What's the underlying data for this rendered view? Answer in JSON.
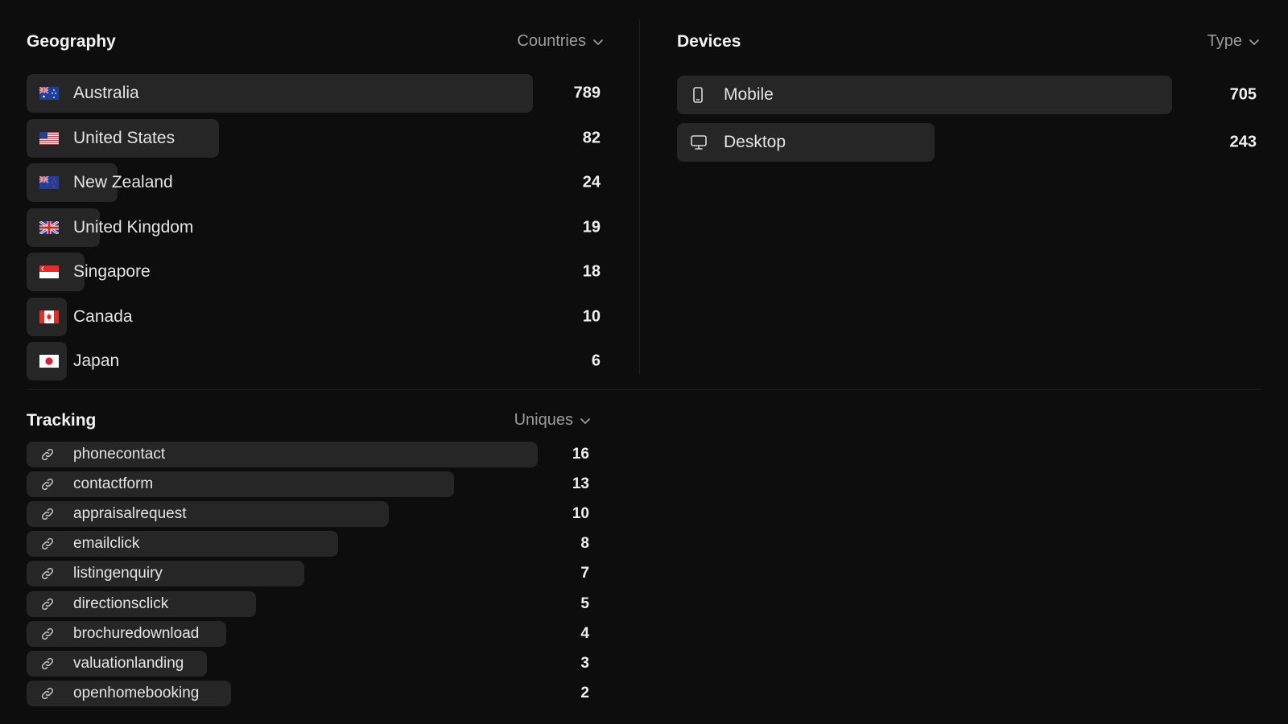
{
  "geography": {
    "title": "Geography",
    "filter_label": "Countries",
    "rows": [
      {
        "label": "Australia",
        "value": "789",
        "fill": 1.0,
        "flag": "au"
      },
      {
        "label": "United States",
        "value": "82",
        "fill": 0.38,
        "flag": "us"
      },
      {
        "label": "New Zealand",
        "value": "24",
        "fill": 0.18,
        "flag": "nz"
      },
      {
        "label": "United Kingdom",
        "value": "19",
        "fill": 0.145,
        "flag": "gb"
      },
      {
        "label": "Singapore",
        "value": "18",
        "fill": 0.115,
        "flag": "sg"
      },
      {
        "label": "Canada",
        "value": "10",
        "fill": 0.08,
        "flag": "ca"
      },
      {
        "label": "Japan",
        "value": "6",
        "fill": 0.08,
        "flag": "jp"
      }
    ]
  },
  "devices": {
    "title": "Devices",
    "filter_label": "Type",
    "rows": [
      {
        "label": "Mobile",
        "value": "705",
        "fill": 1.0,
        "icon": "mobile-icon"
      },
      {
        "label": "Desktop",
        "value": "243",
        "fill": 0.52,
        "icon": "desktop-icon"
      }
    ]
  },
  "tracking": {
    "title": "Tracking",
    "filter_label": "Uniques",
    "rows": [
      {
        "label": "phonecontact",
        "value": "16",
        "fill": 1.0
      },
      {
        "label": "contactform",
        "value": "13",
        "fill": 0.836
      },
      {
        "label": "appraisalrequest",
        "value": "10",
        "fill": 0.708
      },
      {
        "label": "emailclick",
        "value": "8",
        "fill": 0.609
      },
      {
        "label": "listingenquiry",
        "value": "7",
        "fill": 0.543
      },
      {
        "label": "directionsclick",
        "value": "5",
        "fill": 0.449
      },
      {
        "label": "brochuredownload",
        "value": "4",
        "fill": 0.39
      },
      {
        "label": "valuationlanding",
        "value": "3",
        "fill": 0.353
      },
      {
        "label": "openhomebooking",
        "value": "2",
        "fill": 0.4
      }
    ]
  },
  "colors": {
    "background": "#0d0d0e",
    "bar": "#262627",
    "muted": "#9c9c9c"
  }
}
